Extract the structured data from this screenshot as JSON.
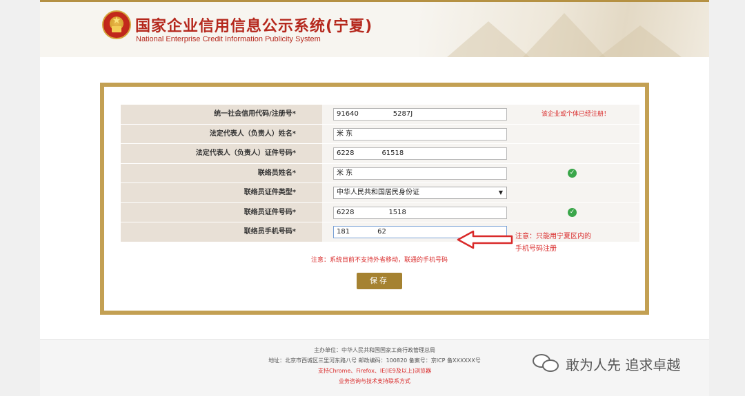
{
  "header": {
    "title_cn": "国家企业信用信息公示系统",
    "title_region": "(宁夏)",
    "title_en": "National Enterprise Credit Information Publicity System"
  },
  "form": {
    "rows": [
      {
        "label": "统一社会信用代码/注册号*",
        "value": "91640　　　　　5287J",
        "message": "该企业或个体已经注册！"
      },
      {
        "label": "法定代表人（负责人）姓名*",
        "value": "米  东"
      },
      {
        "label": "法定代表人（负责人）证件号码*",
        "value": "6228　　　　61518"
      },
      {
        "label": "联络员姓名*",
        "value": "米  东",
        "check": "check-icon"
      },
      {
        "label": "联络员证件类型*",
        "value": "中华人民共和国居民身份证"
      },
      {
        "label": "联络员证件号码*",
        "value": "6228　　　　　1518",
        "check": "check-icon"
      },
      {
        "label": "联络员手机号码*",
        "value": "181　　　　62"
      }
    ],
    "note": "注意：系统目前不支持外省移动，联通的手机号码",
    "save_label": "保存"
  },
  "annotation": {
    "note": "注意：只能用宁夏区内的手机号码注册",
    "color": "#d92a2a"
  },
  "footer": {
    "sponsor": "主办单位：中华人民共和国国家工商行政管理总局",
    "address": "地址：北京市西城区三里河东路八号 邮政编码：100820 备案号：京ICP 备XXXXXX号",
    "browsers": "支持Chrome、Firefox、IE(IE9及以上)浏览器",
    "support": "业务咨询与技术支持联系方式"
  },
  "watermark": {
    "text": "敢为人先 追求卓越"
  },
  "colors": {
    "gold_border": "#c3a053",
    "button": "#a58231",
    "brand_red": "#b5281d"
  }
}
